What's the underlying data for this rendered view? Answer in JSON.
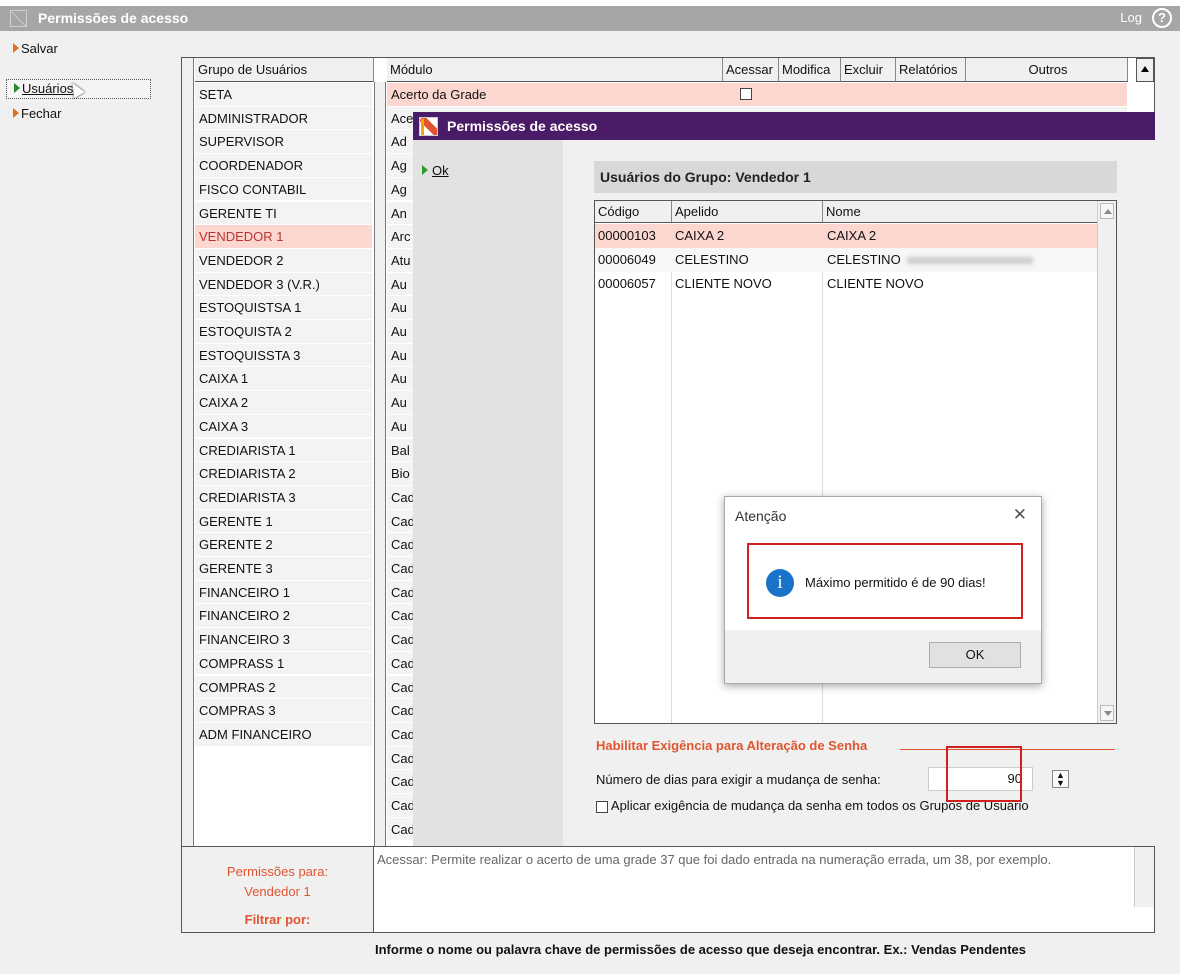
{
  "window": {
    "title": "Permissões de acesso",
    "log_label": "Log",
    "help_icon": "question-circle-icon"
  },
  "left_menu": [
    {
      "label": "Salvar",
      "icon": "arrow-right-icon"
    },
    {
      "label": "Usuários",
      "icon": "arrow-right-icon",
      "selected": true
    },
    {
      "label": "Fechar",
      "icon": "arrow-right-icon"
    }
  ],
  "grid": {
    "columns": [
      "Grupo de Usuários",
      "Módulo",
      "Acessar",
      "Modifica",
      "Excluir",
      "Relatórios",
      "Outros"
    ],
    "groups": [
      "SETA",
      "ADMINISTRADOR",
      "SUPERVISOR",
      "COORDENADOR",
      "FISCO CONTABIL",
      "GERENTE TI",
      "VENDEDOR 1",
      "VENDEDOR 2",
      "VENDEDOR 3 (V.R.)",
      "ESTOQUISTSA 1",
      "ESTOQUISTA 2",
      "ESTOQUISSTA 3",
      "CAIXA 1",
      "CAIXA 2",
      "CAIXA 3",
      "CREDIARISTA 1",
      "CREDIARISTA 2",
      "CREDIARISTA 3",
      "GERENTE 1",
      "GERENTE 2",
      "GERENTE 3",
      "FINANCEIRO 1",
      "FINANCEIRO 2",
      "FINANCEIRO 3",
      "COMPRASS 1",
      "COMPRAS 2",
      "COMPRAS 3",
      "ADM FINANCEIRO"
    ],
    "selected_group_index": 6,
    "modules": [
      "Acerto da Grade",
      "Ace",
      "Ad",
      "Ag",
      "Ag",
      "An",
      "Arc",
      "Atu",
      "Au",
      "Au",
      "Au",
      "Au",
      "Au",
      "Au",
      "Au",
      "Bal",
      "Bio",
      "Cad",
      "Cad",
      "Cad",
      "Cad",
      "Cad",
      "Cad",
      "Cad",
      "Cad",
      "Cad",
      "Cad",
      "Cad",
      "Cad",
      "Cad",
      "Cad",
      "Cad"
    ]
  },
  "bottom": {
    "perm_label": "Permissões para:",
    "perm_group": "Vendedor 1",
    "description": "Acessar: Permite realizar o acerto de uma grade 37 que foi dado entrada na numeração errada, um 38, por exemplo.",
    "filter_label": "Filtrar por:",
    "hint": "Informe o nome ou palavra chave de permissões de acesso que deseja encontrar. Ex.: Vendas Pendentes"
  },
  "dialog": {
    "title": "Permissões de acesso",
    "ok_label": "Ok",
    "group_header": "Usuários do Grupo: Vendedor 1",
    "user_columns": [
      "Código",
      "Apelido",
      "Nome"
    ],
    "users": [
      {
        "code": "00000103",
        "nick": "CAIXA 2",
        "name": "CAIXA 2"
      },
      {
        "code": "00006049",
        "nick": "CELESTINO",
        "name": "CELESTINO"
      },
      {
        "code": "00006057",
        "nick": "CLIENTE NOVO",
        "name": "CLIENTE NOVO"
      }
    ],
    "password_section": "Habilitar Exigência para Alteração de Senha",
    "days_label": "Número de dias para exigir a mudança de senha:",
    "days_value": "90",
    "apply_all_label": "Aplicar exigência de mudança da senha em todos os Grupos de Usuário"
  },
  "alert": {
    "title": "Atenção",
    "message": "Máximo permitido é de 90 dias!",
    "ok_label": "OK",
    "icon": "info-icon",
    "close_icon": "close-icon"
  },
  "colors": {
    "accent": "#e05530",
    "dialog_title": "#4a1b66",
    "selection": "#fbd7cf",
    "highlight_box": "#d02020"
  }
}
